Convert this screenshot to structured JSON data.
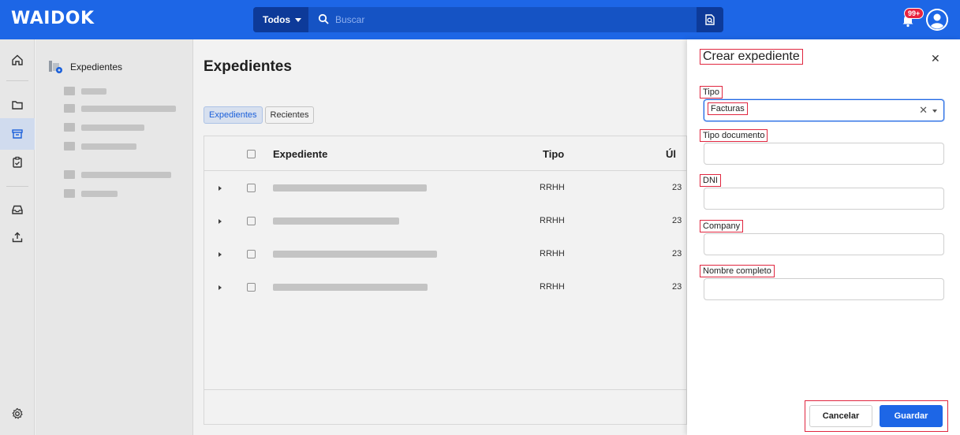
{
  "topbar": {
    "logo": "WAIDOK",
    "search_scope": "Todos",
    "search_placeholder": "Buscar",
    "notifications_badge": "99+"
  },
  "tree": {
    "root_label": "Expedientes"
  },
  "main": {
    "title": "Expedientes",
    "tabs": [
      {
        "label": "Expedientes",
        "active": true
      },
      {
        "label": "Recientes",
        "active": false
      }
    ],
    "columns": {
      "expediente": "Expediente",
      "tipo": "Tipo",
      "ultima": "Úl"
    },
    "rows": [
      {
        "tipo": "RRHH",
        "fecha": "23"
      },
      {
        "tipo": "RRHH",
        "fecha": "23"
      },
      {
        "tipo": "RRHH",
        "fecha": "23"
      },
      {
        "tipo": "RRHH",
        "fecha": "23"
      }
    ]
  },
  "panel": {
    "title": "Crear expediente",
    "fields": {
      "tipo": {
        "label": "Tipo",
        "value": "Facturas"
      },
      "tipo_documento": {
        "label": "Tipo documento",
        "value": ""
      },
      "dni": {
        "label": "DNI",
        "value": ""
      },
      "company": {
        "label": "Company",
        "value": ""
      },
      "nombre_completo": {
        "label": "Nombre completo",
        "value": ""
      }
    },
    "cancel_label": "Cancelar",
    "save_label": "Guardar"
  },
  "colors": {
    "brand_blue": "#1d66e6",
    "highlight_red": "#e0263f",
    "badge_red": "#e8233f"
  }
}
